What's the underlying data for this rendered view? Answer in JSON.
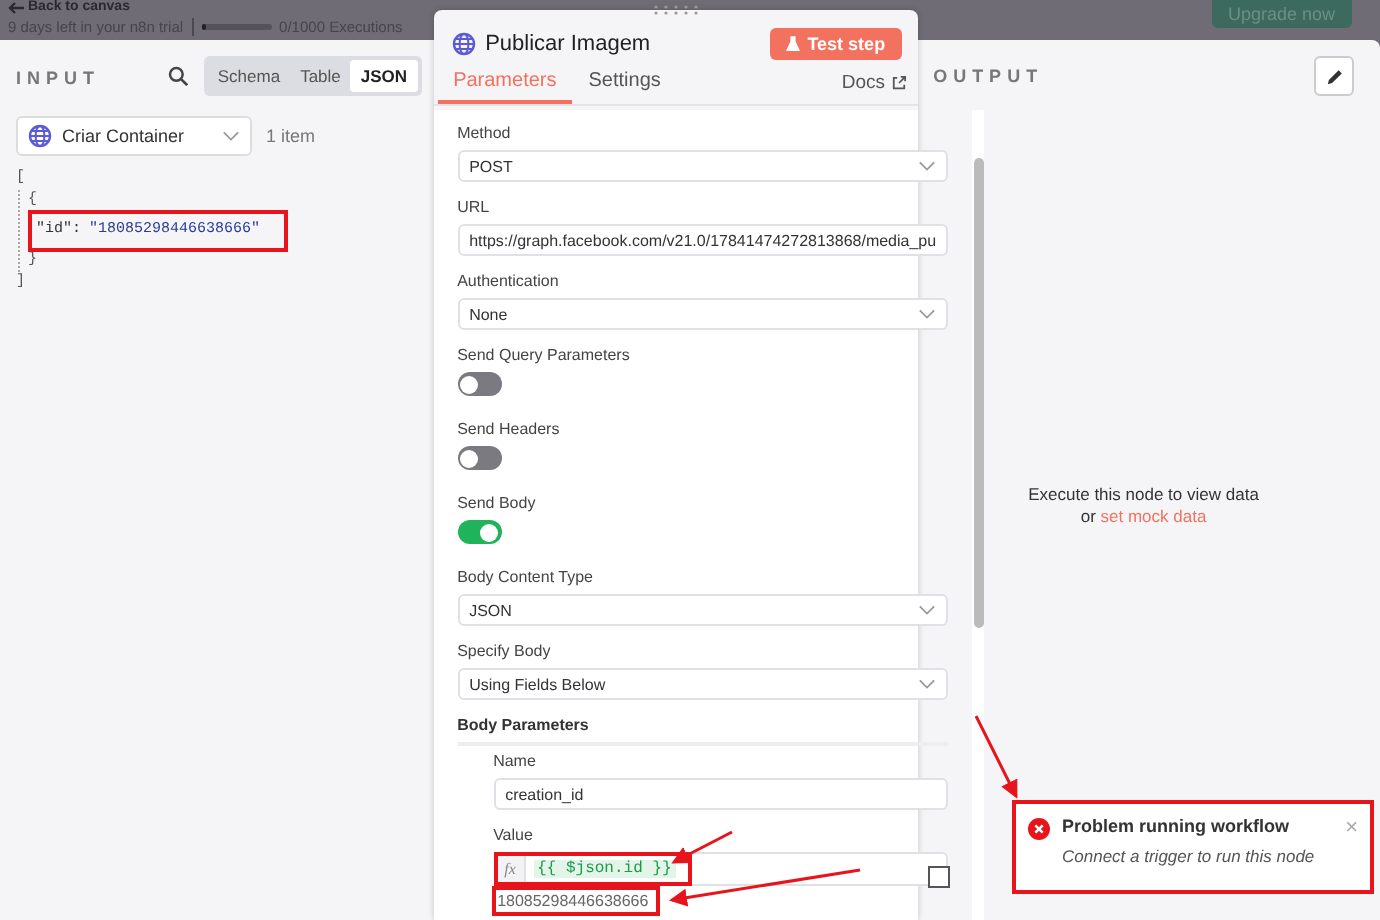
{
  "topbar": {
    "back_link": "Back to canvas",
    "trial": "9 days left in your n8n trial",
    "executions": "0/1000 Executions",
    "executions_level": {
      "level": 0.02
    },
    "upgrade": "Upgrade now"
  },
  "input": {
    "title": "INPUT",
    "view_tabs": [
      {
        "label": "Schema",
        "selected": false
      },
      {
        "label": "Table",
        "selected": false
      },
      {
        "label": "JSON",
        "selected": true
      }
    ],
    "node_select": "Criar Container",
    "item_count": "1 item",
    "json": {
      "open_bracket": "[",
      "open_brace": "{",
      "key": "\"id\":",
      "value": "\"18085298446638666\"",
      "close_brace": "}",
      "close_bracket": "]"
    }
  },
  "node": {
    "title": "Publicar Imagem",
    "test_button": "Test step",
    "tabs": [
      {
        "label": "Parameters",
        "selected": true
      },
      {
        "label": "Settings",
        "selected": false
      }
    ],
    "docs": "Docs",
    "params": [
      {
        "kind": "select",
        "label": "Method",
        "value": "POST"
      },
      {
        "kind": "input",
        "label": "URL",
        "value": "https://graph.facebook.com/v21.0/17841474272813868/media_pu"
      },
      {
        "kind": "select",
        "label": "Authentication",
        "value": "None"
      },
      {
        "kind": "toggle",
        "label": "Send Query Parameters",
        "on": false
      },
      {
        "kind": "toggle",
        "label": "Send Headers",
        "on": false
      },
      {
        "kind": "toggle",
        "label": "Send Body",
        "on": true
      },
      {
        "kind": "select",
        "label": "Body Content Type",
        "value": "JSON"
      },
      {
        "kind": "select",
        "label": "Specify Body",
        "value": "Using Fields Below"
      }
    ],
    "body_parameters": {
      "label": "Body Parameters",
      "name_label": "Name",
      "name_value": "creation_id",
      "value_label": "Value",
      "fx": "fx",
      "expression": "{{ $json.id }}",
      "result": "18085298446638666"
    }
  },
  "output": {
    "title": "OUTPUT",
    "message": "Execute this node to view data",
    "or": "or",
    "mock_link": "set mock data"
  },
  "toast": {
    "title": "Problem running workflow",
    "message": "Connect a trigger to run this node",
    "close": "×"
  }
}
